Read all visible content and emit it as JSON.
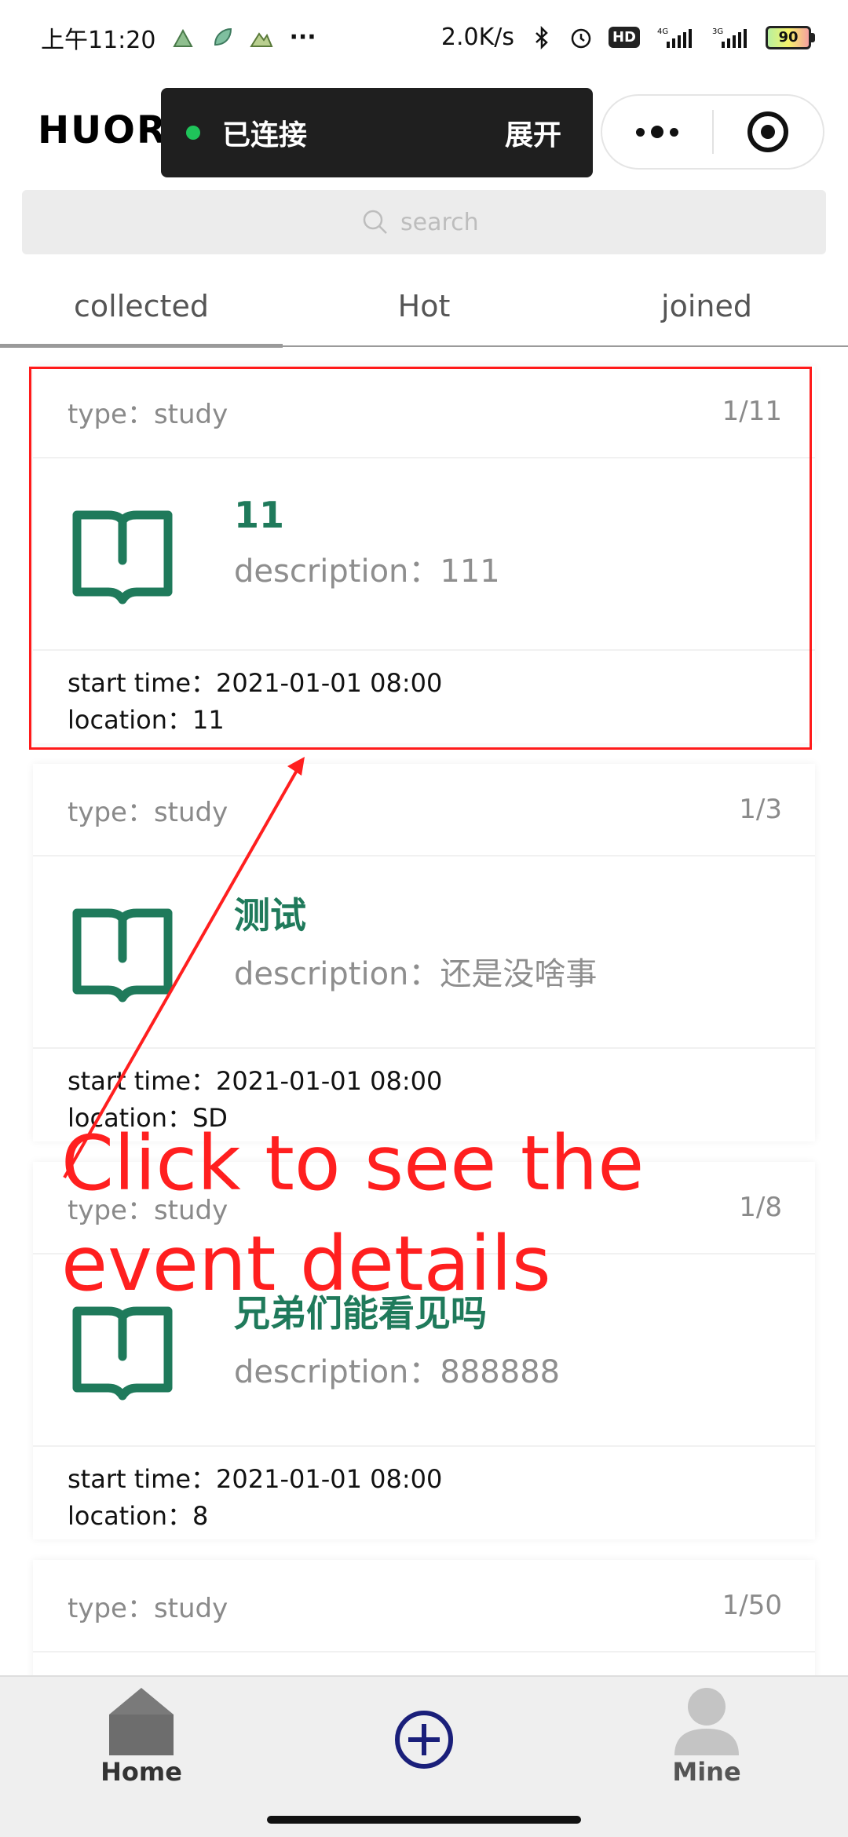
{
  "status_bar": {
    "time": "上午11:20",
    "more": "···",
    "speed": "2.0K/s",
    "network_4g": "4G",
    "network_3g": "3G",
    "hd": "HD",
    "battery": "90"
  },
  "header": {
    "app_name": "HUOR",
    "connection_status": "已连接",
    "expand_label": "展开"
  },
  "search": {
    "placeholder": "search"
  },
  "tabs": [
    {
      "label": "collected",
      "active": true
    },
    {
      "label": "Hot",
      "active": false
    },
    {
      "label": "joined",
      "active": false
    }
  ],
  "events": [
    {
      "type": "type：study",
      "count": "1/11",
      "title": "11",
      "description": "description：111",
      "start_time": "start time：2021-01-01 08:00",
      "location": "location：11"
    },
    {
      "type": "type：study",
      "count": "1/3",
      "title": "测试",
      "description": "description：还是没啥事",
      "start_time": "start time：2021-01-01 08:00",
      "location": "location：SD"
    },
    {
      "type": "type：study",
      "count": "1/8",
      "title": "兄弟们能看见吗",
      "description": "description：888888",
      "start_time": "start time：2021-01-01 08:00",
      "location": "location：8"
    },
    {
      "type": "type：study",
      "count": "1/50"
    }
  ],
  "annotation": {
    "text": "Click to see the event details",
    "color": "#ff1f1f"
  },
  "bottom_nav": {
    "home_label": "Home",
    "mine_label": "Mine"
  },
  "colors": {
    "accent_green": "#1f7a5b",
    "nav_blue": "#1a1f7a",
    "connected_dot": "#1fc45a"
  },
  "icons": {
    "card_icon": "book-icon",
    "search": "search-icon",
    "add": "add-circle-icon",
    "home": "home-icon",
    "mine": "user-icon"
  }
}
